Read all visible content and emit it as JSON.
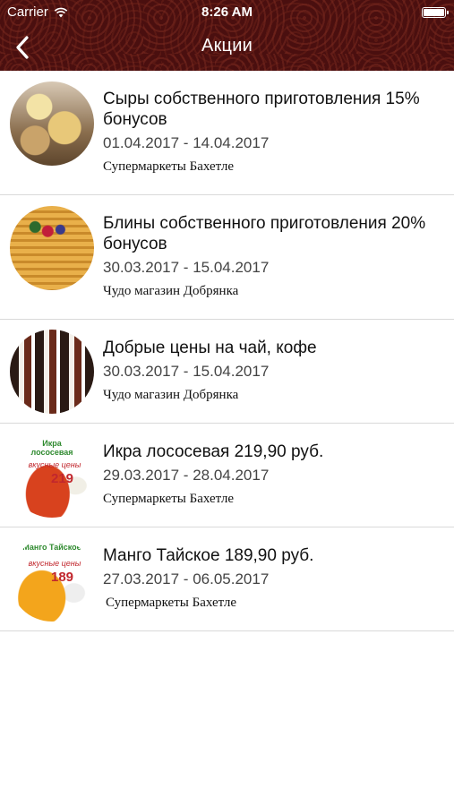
{
  "status_bar": {
    "carrier": "Carrier",
    "time": "8:26 AM"
  },
  "nav": {
    "title": "Акции"
  },
  "promotions": [
    {
      "title": "Сыры собственного приготовления 15% бонусов",
      "dates": "01.04.2017 - 14.04.2017",
      "store": "Супермаркеты Бахетле",
      "image": "cheese-image"
    },
    {
      "title": "Блины собственного приготовления 20% бонусов",
      "dates": "30.03.2017 - 15.04.2017",
      "store": "Чудо магазин Добрянка",
      "image": "pancakes-image"
    },
    {
      "title": "Добрые цены на чай, кофе",
      "dates": "30.03.2017 - 15.04.2017",
      "store": "Чудо магазин Добрянка",
      "image": "tea-coffee-image"
    },
    {
      "title": "Икра лососевая 219,90 руб.",
      "dates": "29.03.2017 - 28.04.2017",
      "store": "Супермаркеты Бахетле",
      "image": "caviar-image",
      "image_text": {
        "name": "Икра лососевая",
        "tagline": "вкусные цены",
        "price": "219"
      }
    },
    {
      "title": "Манго Тайское 189,90 руб.",
      "dates": "27.03.2017 - 06.05.2017",
      "store": "Супермаркеты Бахетле",
      "image": "mango-image",
      "image_text": {
        "name": "Манго Тайское",
        "tagline": "вкусные цены",
        "price": "189"
      }
    }
  ],
  "colors": {
    "header_bg": "#4a0f0f",
    "separator": "#d9d9d9",
    "price_red": "#c1272d",
    "label_green": "#2f8a2f"
  }
}
